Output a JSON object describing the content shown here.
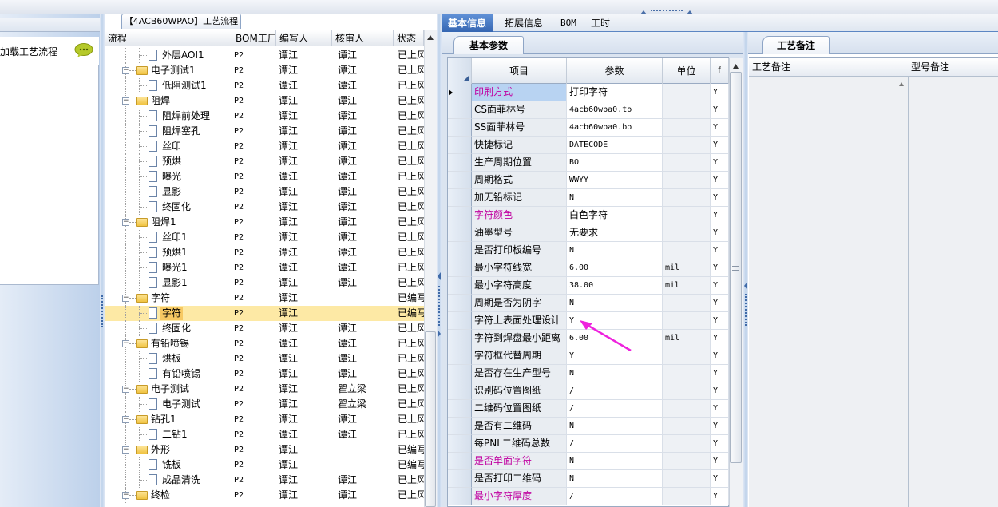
{
  "left_panel": {
    "load_flow_label": "加载工艺流程"
  },
  "flow_tab_title": "【4ACB60WPAO】工艺流程",
  "tree": {
    "columns": [
      "流程",
      "BOM工厂",
      "编写人",
      "核审人",
      "状态"
    ],
    "rows": [
      {
        "name": "外层AOI1",
        "level": 2,
        "type": "file",
        "bom": "P2",
        "writer": "谭江",
        "reviewer": "谭江",
        "status": "已上风"
      },
      {
        "name": "电子测试1",
        "level": 1,
        "type": "folder",
        "bom": "P2",
        "writer": "谭江",
        "reviewer": "谭江",
        "status": "已上风"
      },
      {
        "name": "低阻测试1",
        "level": 2,
        "type": "file",
        "bom": "P2",
        "writer": "谭江",
        "reviewer": "谭江",
        "status": "已上风"
      },
      {
        "name": "阻焊",
        "level": 1,
        "type": "folder",
        "bom": "P2",
        "writer": "谭江",
        "reviewer": "谭江",
        "status": "已上风"
      },
      {
        "name": "阻焊前处理",
        "level": 2,
        "type": "file",
        "bom": "P2",
        "writer": "谭江",
        "reviewer": "谭江",
        "status": "已上风"
      },
      {
        "name": "阻焊塞孔",
        "level": 2,
        "type": "file",
        "bom": "P2",
        "writer": "谭江",
        "reviewer": "谭江",
        "status": "已上风"
      },
      {
        "name": "丝印",
        "level": 2,
        "type": "file",
        "bom": "P2",
        "writer": "谭江",
        "reviewer": "谭江",
        "status": "已上风"
      },
      {
        "name": "预烘",
        "level": 2,
        "type": "file",
        "bom": "P2",
        "writer": "谭江",
        "reviewer": "谭江",
        "status": "已上风"
      },
      {
        "name": "曝光",
        "level": 2,
        "type": "file",
        "bom": "P2",
        "writer": "谭江",
        "reviewer": "谭江",
        "status": "已上风"
      },
      {
        "name": "显影",
        "level": 2,
        "type": "file",
        "bom": "P2",
        "writer": "谭江",
        "reviewer": "谭江",
        "status": "已上风"
      },
      {
        "name": "终固化",
        "level": 2,
        "type": "file",
        "bom": "P2",
        "writer": "谭江",
        "reviewer": "谭江",
        "status": "已上风"
      },
      {
        "name": "阻焊1",
        "level": 1,
        "type": "folder",
        "bom": "P2",
        "writer": "谭江",
        "reviewer": "谭江",
        "status": "已上风"
      },
      {
        "name": "丝印1",
        "level": 2,
        "type": "file",
        "bom": "P2",
        "writer": "谭江",
        "reviewer": "谭江",
        "status": "已上风"
      },
      {
        "name": "预烘1",
        "level": 2,
        "type": "file",
        "bom": "P2",
        "writer": "谭江",
        "reviewer": "谭江",
        "status": "已上风"
      },
      {
        "name": "曝光1",
        "level": 2,
        "type": "file",
        "bom": "P2",
        "writer": "谭江",
        "reviewer": "谭江",
        "status": "已上风"
      },
      {
        "name": "显影1",
        "level": 2,
        "type": "file",
        "bom": "P2",
        "writer": "谭江",
        "reviewer": "谭江",
        "status": "已上风"
      },
      {
        "name": "字符",
        "level": 1,
        "type": "folder",
        "bom": "P2",
        "writer": "谭江",
        "reviewer": "",
        "status": "已编写"
      },
      {
        "name": "字符",
        "level": 2,
        "type": "file",
        "bom": "P2",
        "writer": "谭江",
        "reviewer": "",
        "status": "已编写",
        "selected": true
      },
      {
        "name": "终固化",
        "level": 2,
        "type": "file",
        "bom": "P2",
        "writer": "谭江",
        "reviewer": "谭江",
        "status": "已上风"
      },
      {
        "name": "有铅喷锡",
        "level": 1,
        "type": "folder",
        "bom": "P2",
        "writer": "谭江",
        "reviewer": "谭江",
        "status": "已上风"
      },
      {
        "name": "烘板",
        "level": 2,
        "type": "file",
        "bom": "P2",
        "writer": "谭江",
        "reviewer": "谭江",
        "status": "已上风"
      },
      {
        "name": "有铅喷锡",
        "level": 2,
        "type": "file",
        "bom": "P2",
        "writer": "谭江",
        "reviewer": "谭江",
        "status": "已上风"
      },
      {
        "name": "电子测试",
        "level": 1,
        "type": "folder",
        "bom": "P2",
        "writer": "谭江",
        "reviewer": "翟立梁",
        "status": "已上风"
      },
      {
        "name": "电子测试",
        "level": 2,
        "type": "file",
        "bom": "P2",
        "writer": "谭江",
        "reviewer": "翟立梁",
        "status": "已上风"
      },
      {
        "name": "钻孔1",
        "level": 1,
        "type": "folder",
        "bom": "P2",
        "writer": "谭江",
        "reviewer": "谭江",
        "status": "已上风"
      },
      {
        "name": "二钻1",
        "level": 2,
        "type": "file",
        "bom": "P2",
        "writer": "谭江",
        "reviewer": "谭江",
        "status": "已上风"
      },
      {
        "name": "外形",
        "level": 1,
        "type": "folder",
        "bom": "P2",
        "writer": "谭江",
        "reviewer": "",
        "status": "已编写"
      },
      {
        "name": "铣板",
        "level": 2,
        "type": "file",
        "bom": "P2",
        "writer": "谭江",
        "reviewer": "",
        "status": "已编写"
      },
      {
        "name": "成品清洗",
        "level": 2,
        "type": "file",
        "bom": "P2",
        "writer": "谭江",
        "reviewer": "谭江",
        "status": "已上风"
      },
      {
        "name": "终检",
        "level": 1,
        "type": "folder",
        "bom": "P2",
        "writer": "谭江",
        "reviewer": "谭江",
        "status": "已上风"
      }
    ]
  },
  "right_tabs": [
    "基本信息",
    "拓展信息",
    "BOM",
    "工时"
  ],
  "base_panel": {
    "tab_label": "基本参数",
    "columns": [
      "项目",
      "参数",
      "单位",
      "f"
    ],
    "rows": [
      {
        "item": "印刷方式",
        "param": "打印字符",
        "unit": "",
        "flag": "Y",
        "color": "#c000a0",
        "highlight": true,
        "current": true
      },
      {
        "item": "CS面菲林号",
        "param": "4acb60wpa0.to",
        "unit": "",
        "flag": "Y"
      },
      {
        "item": "SS面菲林号",
        "param": "4acb60wpa0.bo",
        "unit": "",
        "flag": "Y"
      },
      {
        "item": "快捷标记",
        "param": "DATECODE",
        "unit": "",
        "flag": "Y"
      },
      {
        "item": "生产周期位置",
        "param": "BO",
        "unit": "",
        "flag": "Y"
      },
      {
        "item": "周期格式",
        "param": "WWYY",
        "unit": "",
        "flag": "Y"
      },
      {
        "item": "加无铅标记",
        "param": "N",
        "unit": "",
        "flag": "Y"
      },
      {
        "item": "字符颜色",
        "param": "白色字符",
        "unit": "",
        "flag": "Y",
        "color": "#c000a0"
      },
      {
        "item": "油墨型号",
        "param": "无要求",
        "unit": "",
        "flag": "Y"
      },
      {
        "item": "是否打印板编号",
        "param": "N",
        "unit": "",
        "flag": "Y"
      },
      {
        "item": "最小字符线宽",
        "param": "6.00",
        "unit": "mil",
        "flag": "Y"
      },
      {
        "item": "最小字符高度",
        "param": "38.00",
        "unit": "mil",
        "flag": "Y"
      },
      {
        "item": "周期是否为阴字",
        "param": "N",
        "unit": "",
        "flag": "Y"
      },
      {
        "item": "字符上表面处理设计",
        "param": "Y",
        "unit": "",
        "flag": "Y"
      },
      {
        "item": "字符到焊盘最小距离",
        "param": "6.00",
        "unit": "mil",
        "flag": "Y"
      },
      {
        "item": "字符框代替周期",
        "param": "Y",
        "unit": "",
        "flag": "Y"
      },
      {
        "item": "是否存在生产型号",
        "param": "N",
        "unit": "",
        "flag": "Y"
      },
      {
        "item": "识别码位置图纸",
        "param": "/",
        "unit": "",
        "flag": "Y"
      },
      {
        "item": "二维码位置图纸",
        "param": "/",
        "unit": "",
        "flag": "Y"
      },
      {
        "item": "是否有二维码",
        "param": "N",
        "unit": "",
        "flag": "Y"
      },
      {
        "item": "每PNL二维码总数",
        "param": "/",
        "unit": "",
        "flag": "Y"
      },
      {
        "item": "是否单面字符",
        "param": "N",
        "unit": "",
        "flag": "Y",
        "color": "#c000a0"
      },
      {
        "item": "是否打印二维码",
        "param": "N",
        "unit": "",
        "flag": "Y"
      },
      {
        "item": "最小字符厚度",
        "param": "/",
        "unit": "",
        "flag": "Y",
        "color": "#c000a0"
      }
    ]
  },
  "remark_panel": {
    "tab_label": "工艺备注",
    "columns": [
      "工艺备注",
      "型号备注"
    ]
  },
  "colors": {
    "accent_blue": "#3566b2",
    "pink_label": "#c000a0",
    "selected_row": "#fde9a5",
    "arrow": "#ee22dd"
  },
  "icons": {
    "bubble": "speech-bubble-icon",
    "arrow": "pink-arrow-annotation"
  }
}
